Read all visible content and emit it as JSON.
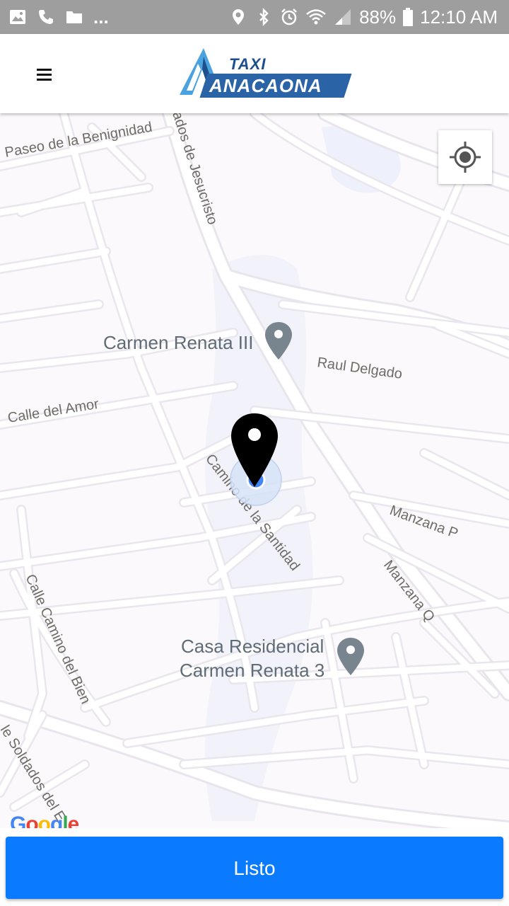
{
  "status_bar": {
    "left_icons": [
      "image-icon",
      "phone-icon",
      "folder-icon"
    ],
    "ellipsis": "...",
    "right_icons": [
      "location-icon",
      "bluetooth-icon",
      "alarm-icon",
      "wifi-icon",
      "signal-icon"
    ],
    "battery": "88%",
    "time": "12:10 AM"
  },
  "app_bar": {
    "menu_icon": "hamburger-menu-icon",
    "logo_top": "TAXI",
    "logo_main": "ANACAONA"
  },
  "map": {
    "streets": [
      "Paseo de la Benignidad",
      "ados de Jesucristo",
      "Raul Delgado",
      "Calle del Amor",
      "Camino de la Santidad",
      "Manzana P",
      "Manzana Q",
      "Calle Camino del Bien",
      "le Soldados del E"
    ],
    "places": [
      {
        "name_lines": [
          "Carmen Renata III"
        ]
      },
      {
        "name_lines": [
          "Casa Residencial",
          "Carmen Renata 3"
        ]
      }
    ],
    "my_location_button_icon": "my-location-crosshair-icon",
    "marker_icon": "map-pin-icon",
    "attribution": "Google"
  },
  "action": {
    "button_label": "Listo"
  },
  "colors": {
    "status_bar": "#9e9e9e",
    "accent_button": "#0a7bff",
    "logo_blue": "#2a64a6",
    "map_road": "#ffffff",
    "map_bg": "#fbf9fb",
    "poi_gray": "#6b7782",
    "user_dot": "#4285f4"
  }
}
